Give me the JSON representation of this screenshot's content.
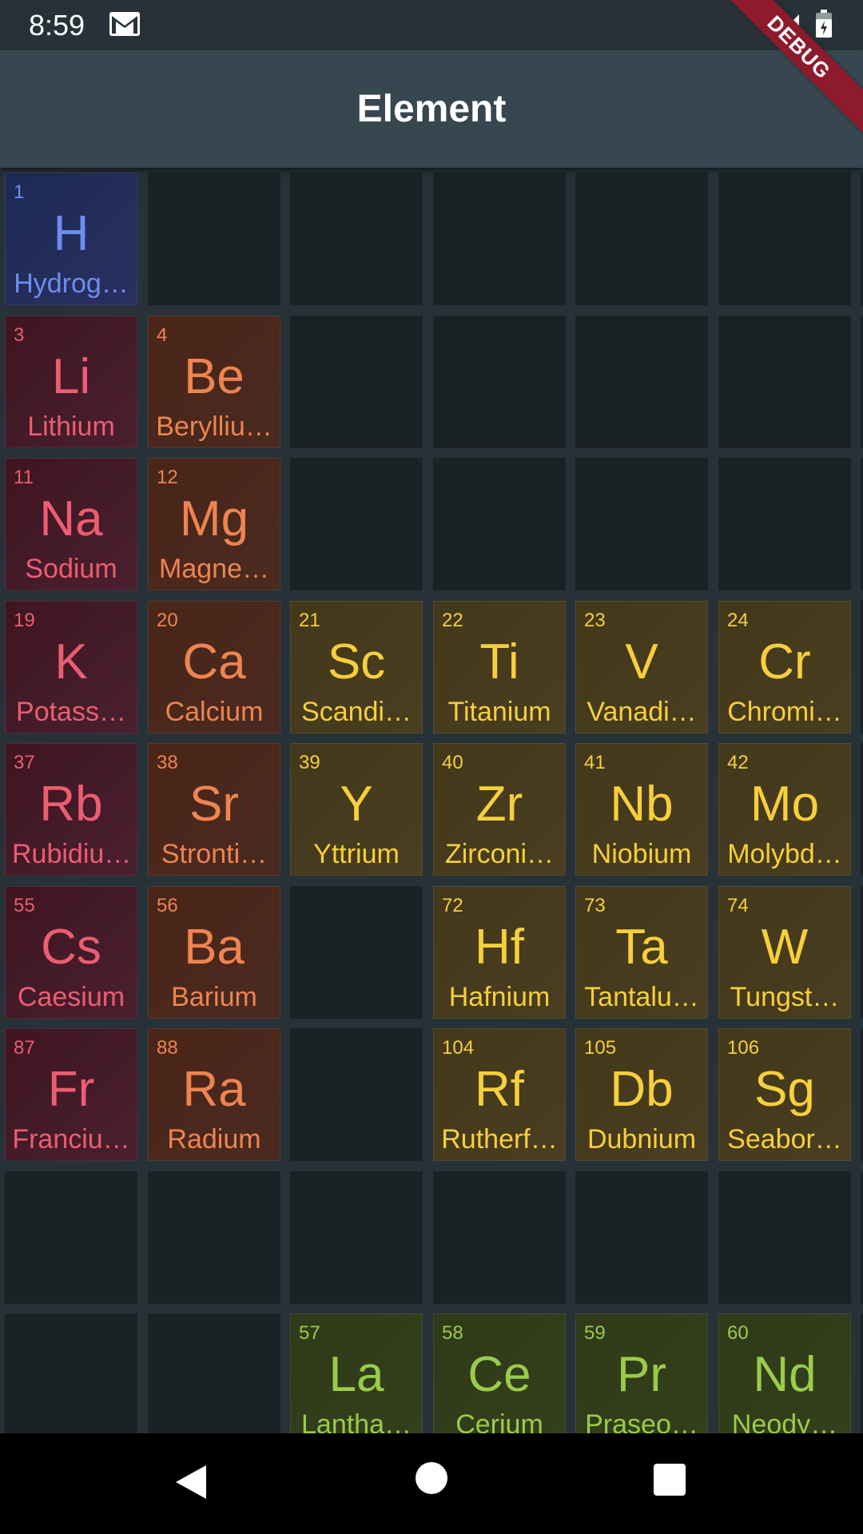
{
  "status_bar": {
    "time": "8:59",
    "icons": [
      "gmail-icon",
      "signal-icon",
      "battery-icon"
    ]
  },
  "app_bar": {
    "title": "Element"
  },
  "debug_banner": "DEBUG",
  "colors": {
    "app_bar": "#37474f",
    "background": "#263238",
    "empty_cell": "#1b2226",
    "hydrogen": "#6e8cf0",
    "alkali_metal": "#ec5d72",
    "alkaline_earth_metal": "#ee8450",
    "transition_metal": "#f7cf3c",
    "lanthanide": "#9acb4c"
  },
  "elements": [
    {
      "number": "1",
      "symbol": "H",
      "name": "Hydrog…",
      "category": "h",
      "row": 0,
      "col": 0
    },
    {
      "number": "3",
      "symbol": "Li",
      "name": "Lithium",
      "category": "alk",
      "row": 1,
      "col": 0
    },
    {
      "number": "4",
      "symbol": "Be",
      "name": "Berylliu…",
      "category": "ae",
      "row": 1,
      "col": 1
    },
    {
      "number": "11",
      "symbol": "Na",
      "name": "Sodium",
      "category": "alk",
      "row": 2,
      "col": 0
    },
    {
      "number": "12",
      "symbol": "Mg",
      "name": "Magne…",
      "category": "ae",
      "row": 2,
      "col": 1
    },
    {
      "number": "19",
      "symbol": "K",
      "name": "Potass…",
      "category": "alk",
      "row": 3,
      "col": 0
    },
    {
      "number": "20",
      "symbol": "Ca",
      "name": "Calcium",
      "category": "ae",
      "row": 3,
      "col": 1
    },
    {
      "number": "21",
      "symbol": "Sc",
      "name": "Scandi…",
      "category": "tm",
      "row": 3,
      "col": 2
    },
    {
      "number": "22",
      "symbol": "Ti",
      "name": "Titanium",
      "category": "tm",
      "row": 3,
      "col": 3
    },
    {
      "number": "23",
      "symbol": "V",
      "name": "Vanadi…",
      "category": "tm",
      "row": 3,
      "col": 4
    },
    {
      "number": "24",
      "symbol": "Cr",
      "name": "Chromi…",
      "category": "tm",
      "row": 3,
      "col": 5
    },
    {
      "number": "37",
      "symbol": "Rb",
      "name": "Rubidiu…",
      "category": "alk",
      "row": 4,
      "col": 0
    },
    {
      "number": "38",
      "symbol": "Sr",
      "name": "Stronti…",
      "category": "ae",
      "row": 4,
      "col": 1
    },
    {
      "number": "39",
      "symbol": "Y",
      "name": "Yttrium",
      "category": "tm",
      "row": 4,
      "col": 2
    },
    {
      "number": "40",
      "symbol": "Zr",
      "name": "Zirconi…",
      "category": "tm",
      "row": 4,
      "col": 3
    },
    {
      "number": "41",
      "symbol": "Nb",
      "name": "Niobium",
      "category": "tm",
      "row": 4,
      "col": 4
    },
    {
      "number": "42",
      "symbol": "Mo",
      "name": "Molybd…",
      "category": "tm",
      "row": 4,
      "col": 5
    },
    {
      "number": "55",
      "symbol": "Cs",
      "name": "Caesium",
      "category": "alk",
      "row": 5,
      "col": 0
    },
    {
      "number": "56",
      "symbol": "Ba",
      "name": "Barium",
      "category": "ae",
      "row": 5,
      "col": 1
    },
    {
      "number": "72",
      "symbol": "Hf",
      "name": "Hafnium",
      "category": "tm",
      "row": 5,
      "col": 3
    },
    {
      "number": "73",
      "symbol": "Ta",
      "name": "Tantalu…",
      "category": "tm",
      "row": 5,
      "col": 4
    },
    {
      "number": "74",
      "symbol": "W",
      "name": "Tungst…",
      "category": "tm",
      "row": 5,
      "col": 5
    },
    {
      "number": "87",
      "symbol": "Fr",
      "name": "Franciu…",
      "category": "alk",
      "row": 6,
      "col": 0
    },
    {
      "number": "88",
      "symbol": "Ra",
      "name": "Radium",
      "category": "ae",
      "row": 6,
      "col": 1
    },
    {
      "number": "104",
      "symbol": "Rf",
      "name": "Rutherf…",
      "category": "tm",
      "row": 6,
      "col": 3
    },
    {
      "number": "105",
      "symbol": "Db",
      "name": "Dubnium",
      "category": "tm",
      "row": 6,
      "col": 4
    },
    {
      "number": "106",
      "symbol": "Sg",
      "name": "Seabor…",
      "category": "tm",
      "row": 6,
      "col": 5
    },
    {
      "number": "57",
      "symbol": "La",
      "name": "Lantha…",
      "category": "la",
      "row": 8,
      "col": 2
    },
    {
      "number": "58",
      "symbol": "Ce",
      "name": "Cerium",
      "category": "la",
      "row": 8,
      "col": 3
    },
    {
      "number": "59",
      "symbol": "Pr",
      "name": "Praseo…",
      "category": "la",
      "row": 8,
      "col": 4
    },
    {
      "number": "60",
      "symbol": "Nd",
      "name": "Neody…",
      "category": "la",
      "row": 8,
      "col": 5
    }
  ],
  "nav_bar": {
    "icons": [
      "back-icon",
      "home-icon",
      "recents-icon"
    ]
  }
}
